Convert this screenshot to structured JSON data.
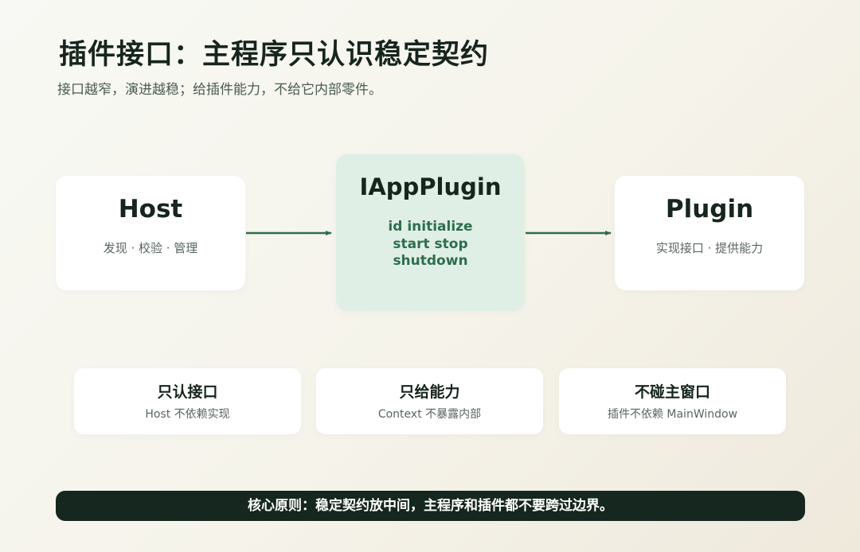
{
  "title": "插件接口：主程序只认识稳定契约",
  "subtitle": "接口越窄，演进越稳；给插件能力，不给它内部零件。",
  "diagram": {
    "host": {
      "name": "Host",
      "desc": "发现 · 校验 · 管理"
    },
    "interface": {
      "name": "IAppPlugin",
      "methods": [
        "id  initialize",
        "start  stop",
        "shutdown"
      ]
    },
    "plugin": {
      "name": "Plugin",
      "desc": "实现接口 · 提供能力"
    },
    "arrow_color": "#2e6e4d"
  },
  "principles": [
    {
      "title": "只认接口",
      "desc": "Host 不依赖实现"
    },
    {
      "title": "只给能力",
      "desc": "Context 不暴露内部"
    },
    {
      "title": "不碰主窗口",
      "desc": "插件不依赖 MainWindow"
    }
  ],
  "footer": "核心原则：稳定契约放中间，主程序和插件都不要跨过边界。",
  "colors": {
    "accent": "#2e6e4d",
    "interface_bg": "#e0efe6",
    "footer_bg": "#15271e"
  }
}
